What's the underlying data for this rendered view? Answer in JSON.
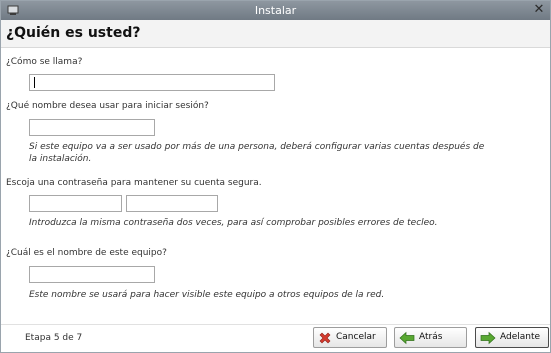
{
  "window": {
    "title": "Instalar",
    "close_glyph": "✕"
  },
  "header": {
    "title": "¿Quién es usted?"
  },
  "form": {
    "name_label": "¿Cómo se llama?",
    "name_value": "",
    "username_label": "¿Qué nombre desea usar para iniciar sesión?",
    "username_value": "",
    "username_hint_line1": "Si este equipo va a ser usado por más de una persona, deberá configurar varias cuentas después de",
    "username_hint_line2": "la instalación.",
    "password_label": "Escoja una contraseña para mantener su cuenta segura.",
    "password_value": "",
    "password_confirm_value": "",
    "password_hint": "Introduzca la misma contraseña dos veces, para así comprobar posibles errores de tecleo.",
    "hostname_label": "¿Cuál es el nombre de este equipo?",
    "hostname_value": "",
    "hostname_hint": "Este nombre se usará para hacer visible este equipo a otros equipos de la red."
  },
  "footer": {
    "step_text": "Etapa 5 de 7",
    "cancel_label": "Cancelar",
    "back_label": "Atrás",
    "forward_label": "Adelante"
  },
  "icons": {
    "app": "installer-icon",
    "close": "close-icon",
    "cancel": "cancel-icon",
    "back": "back-arrow-icon",
    "forward": "forward-arrow-icon"
  },
  "colors": {
    "titlebar": "#7d8790",
    "cancel_icon": "#d43b2f",
    "arrow_icon": "#59a832"
  }
}
